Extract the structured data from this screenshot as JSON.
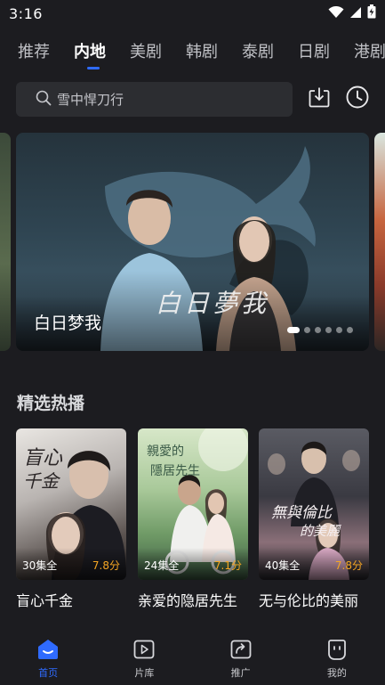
{
  "status_bar": {
    "time": "3:16"
  },
  "tabs": [
    {
      "label": "推荐",
      "active": false
    },
    {
      "label": "内地",
      "active": true
    },
    {
      "label": "美剧",
      "active": false
    },
    {
      "label": "韩剧",
      "active": false
    },
    {
      "label": "泰剧",
      "active": false
    },
    {
      "label": "日剧",
      "active": false
    },
    {
      "label": "港剧",
      "active": false
    }
  ],
  "search": {
    "query": "雪中悍刀行"
  },
  "actions": {
    "download_icon": "download-icon",
    "history_icon": "clock-icon"
  },
  "banner": {
    "title": "白日梦我",
    "logo_text": "白日夢我",
    "dot_count": 6,
    "active_dot": 0
  },
  "section": {
    "title": "精选热播"
  },
  "cards": [
    {
      "title": "盲心千金",
      "episodes": "30集全",
      "score": "7.8分"
    },
    {
      "title": "亲爱的隐居先生",
      "episodes": "24集全",
      "score": "7.1分"
    },
    {
      "title": "无与伦比的美丽",
      "episodes": "40集全",
      "score": "7.8分"
    }
  ],
  "bottom_nav": [
    {
      "label": "首页",
      "icon": "home-icon",
      "active": true
    },
    {
      "label": "片库",
      "icon": "video-library-icon",
      "active": false
    },
    {
      "label": "推广",
      "icon": "share-icon",
      "active": false
    },
    {
      "label": "我的",
      "icon": "profile-face-icon",
      "active": false
    }
  ],
  "colors": {
    "accent": "#2f6bff",
    "score": "#f5a623",
    "background": "#1c1c20"
  }
}
